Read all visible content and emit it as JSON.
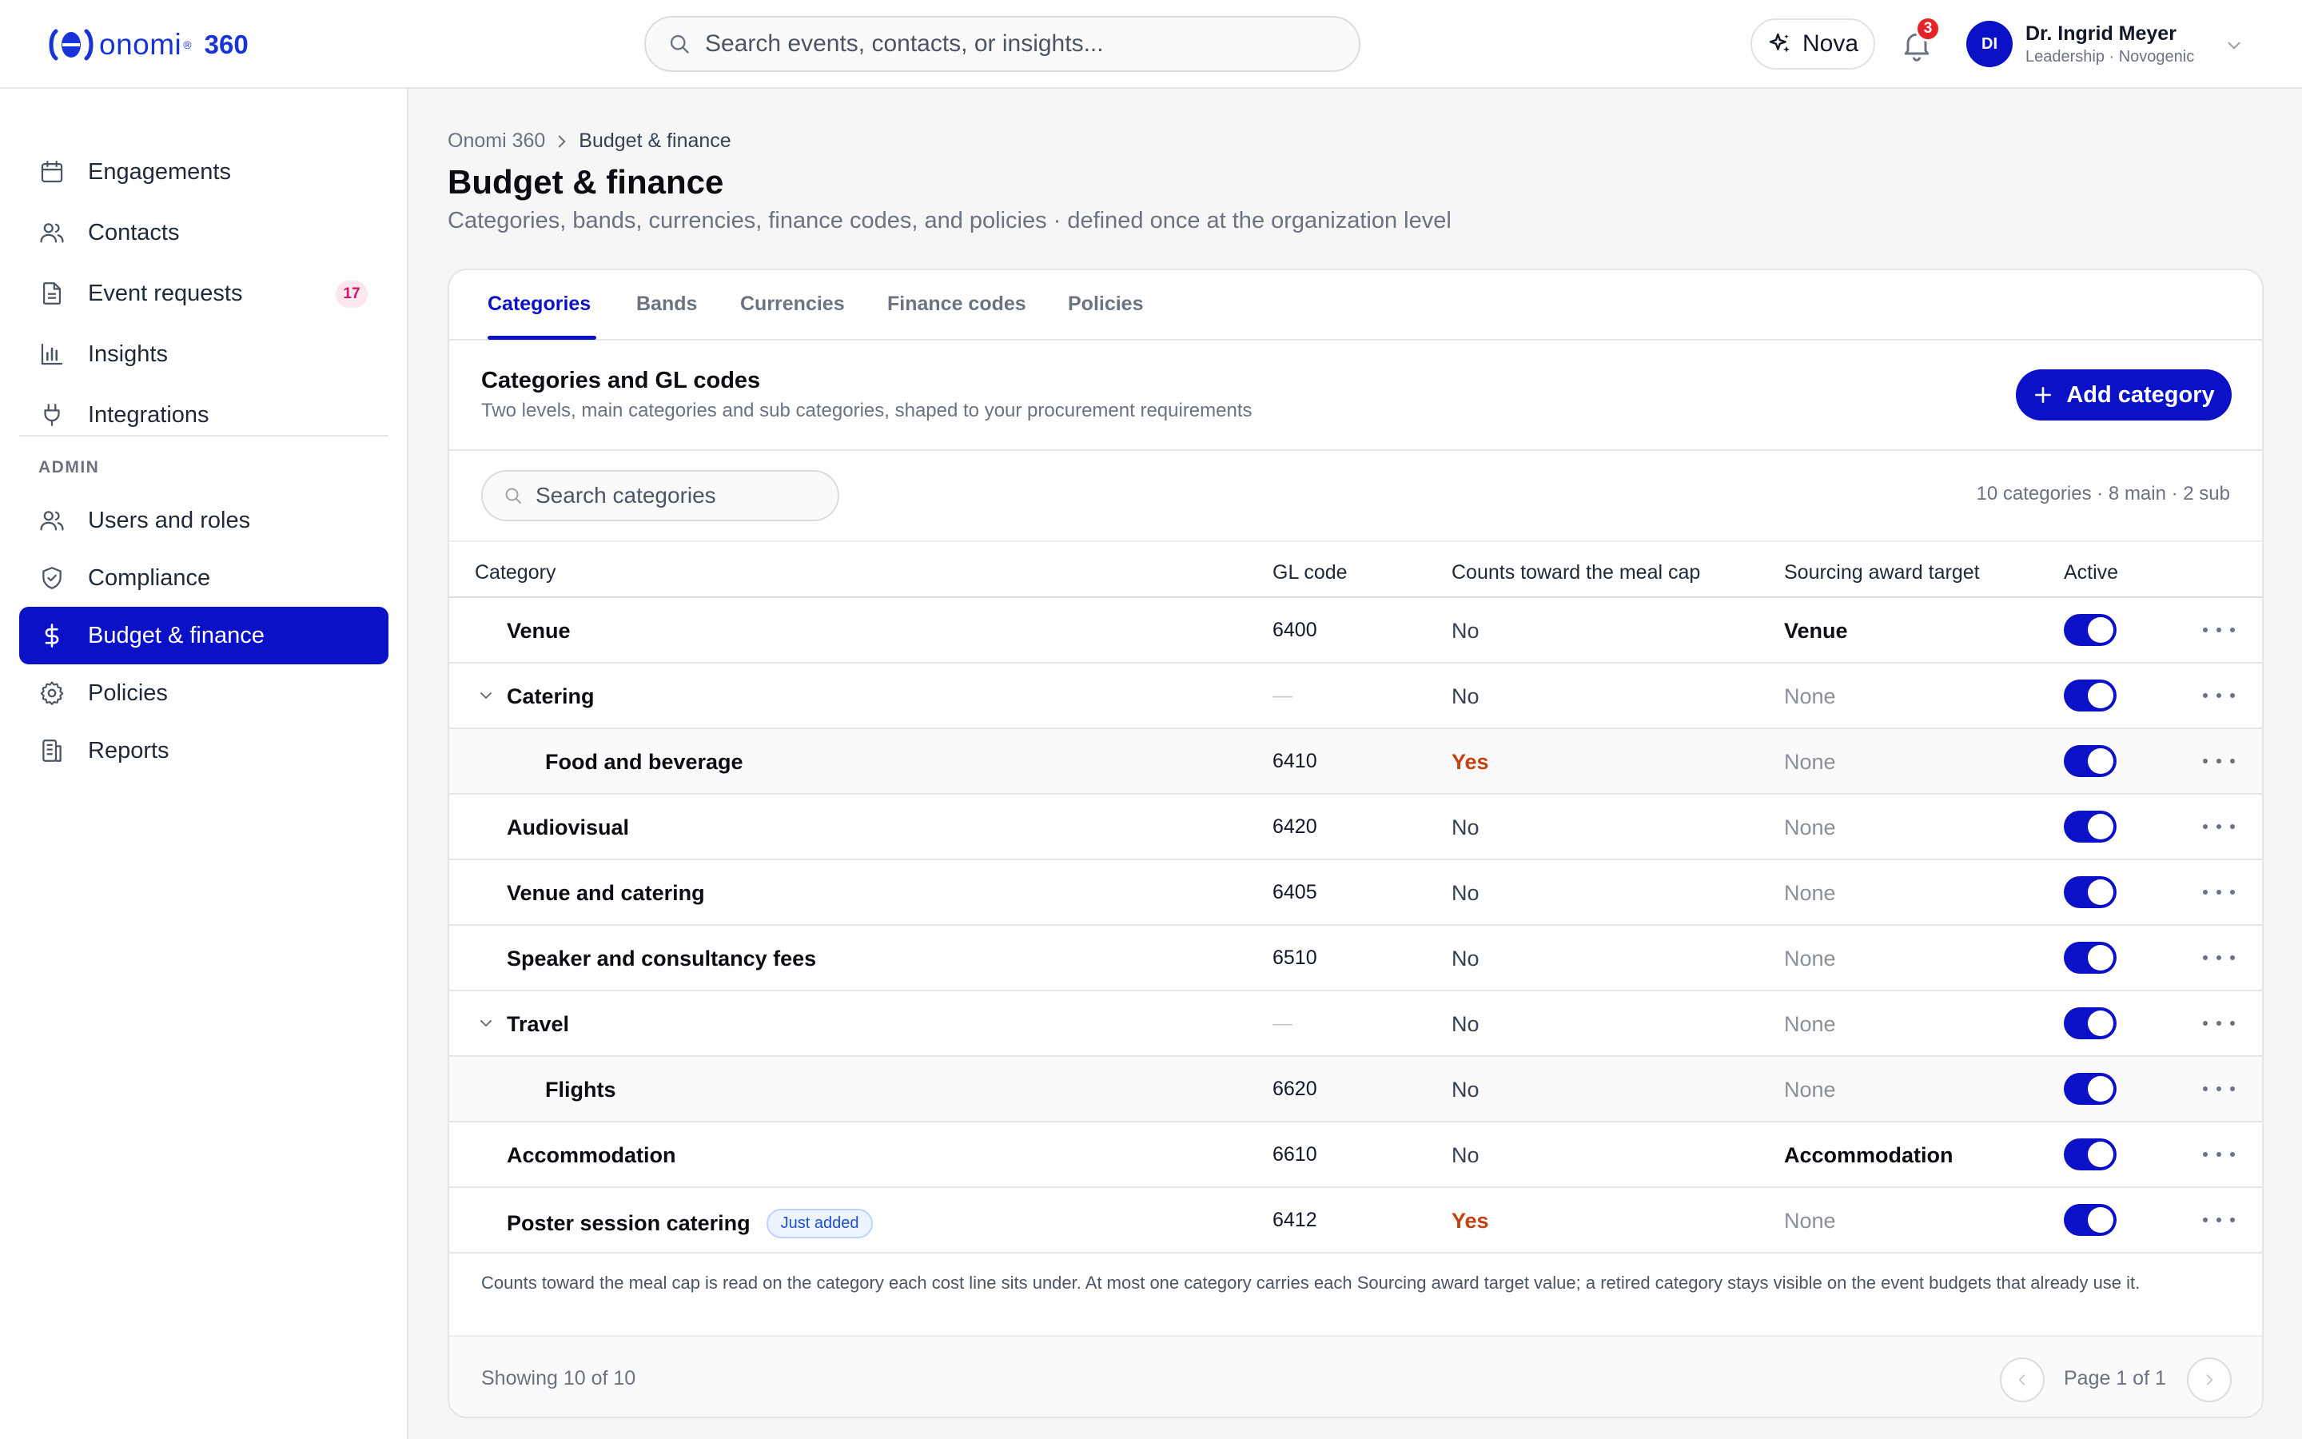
{
  "app": {
    "logo_word": "onomi",
    "logo_reg": "®",
    "logo_suffix": "360"
  },
  "header": {
    "search_placeholder": "Search events, contacts, or insights...",
    "nova_label": "Nova",
    "notifications_count": "3",
    "user": {
      "initials": "DI",
      "name": "Dr. Ingrid Meyer",
      "org": "Leadership · Novogenic"
    }
  },
  "sidebar": {
    "items": [
      {
        "label": "Engagements",
        "icon": "calendar-icon"
      },
      {
        "label": "Contacts",
        "icon": "users-icon"
      },
      {
        "label": "Event requests",
        "icon": "document-icon",
        "badge": "17"
      },
      {
        "label": "Insights",
        "icon": "bar-chart-icon"
      },
      {
        "label": "Integrations",
        "icon": "plug-icon"
      }
    ],
    "admin_label": "ADMIN",
    "admin_items": [
      {
        "label": "Users and roles",
        "icon": "users-icon"
      },
      {
        "label": "Compliance",
        "icon": "shield-icon"
      },
      {
        "label": "Budget & finance",
        "icon": "dollar-icon",
        "active": true
      },
      {
        "label": "Policies",
        "icon": "gear-icon"
      },
      {
        "label": "Reports",
        "icon": "reports-icon"
      }
    ]
  },
  "page": {
    "breadcrumb": [
      "Onomi 360",
      "Budget & finance"
    ],
    "title": "Budget & finance",
    "subtitle": "Categories, bands, currencies, finance codes, and policies · defined once at the organization level"
  },
  "tabs": [
    "Categories",
    "Bands",
    "Currencies",
    "Finance codes",
    "Policies"
  ],
  "active_tab": "Categories",
  "section": {
    "title": "Categories and GL codes",
    "subtitle": "Two levels, main categories and sub categories, shaped to your procurement requirements",
    "add_button": "Add category",
    "search_placeholder": "Search categories",
    "counts": "10 categories · 8 main · 2 sub"
  },
  "table": {
    "columns": [
      "Category",
      "GL code",
      "Counts toward the meal cap",
      "Sourcing award target",
      "Active"
    ],
    "rows": [
      {
        "name": "Venue",
        "gl": "6400",
        "meal": "No",
        "sourcing": "Venue",
        "active": true,
        "level": "main"
      },
      {
        "name": "Catering",
        "gl": "—",
        "meal": "No",
        "sourcing": "None",
        "active": true,
        "level": "main",
        "expanded": true
      },
      {
        "name": "Food and beverage",
        "gl": "6410",
        "meal": "Yes",
        "sourcing": "None",
        "active": true,
        "level": "sub"
      },
      {
        "name": "Audiovisual",
        "gl": "6420",
        "meal": "No",
        "sourcing": "None",
        "active": true,
        "level": "main"
      },
      {
        "name": "Venue and catering",
        "gl": "6405",
        "meal": "No",
        "sourcing": "None",
        "active": true,
        "level": "main"
      },
      {
        "name": "Speaker and consultancy fees",
        "gl": "6510",
        "meal": "No",
        "sourcing": "None",
        "active": true,
        "level": "main"
      },
      {
        "name": "Travel",
        "gl": "—",
        "meal": "No",
        "sourcing": "None",
        "active": true,
        "level": "main",
        "expanded": true
      },
      {
        "name": "Flights",
        "gl": "6620",
        "meal": "No",
        "sourcing": "None",
        "active": true,
        "level": "sub"
      },
      {
        "name": "Accommodation",
        "gl": "6610",
        "meal": "No",
        "sourcing": "Accommodation",
        "active": true,
        "level": "main"
      },
      {
        "name": "Poster session catering",
        "gl": "6412",
        "meal": "Yes",
        "sourcing": "None",
        "active": true,
        "level": "main",
        "tag": "Just added"
      }
    ]
  },
  "footnote": "Counts toward the meal cap is read on the category each cost line sits under. At most one category carries each Sourcing award target value; a retired category stays visible on the event budgets that already use it.",
  "footer": {
    "showing": "Showing 10 of 10",
    "page_label": "Page 1 of 1"
  },
  "colors": {
    "brand": "#0a11c7",
    "logo": "#1834d6",
    "yes": "#c2410c",
    "badge_red": "#e5232b"
  }
}
